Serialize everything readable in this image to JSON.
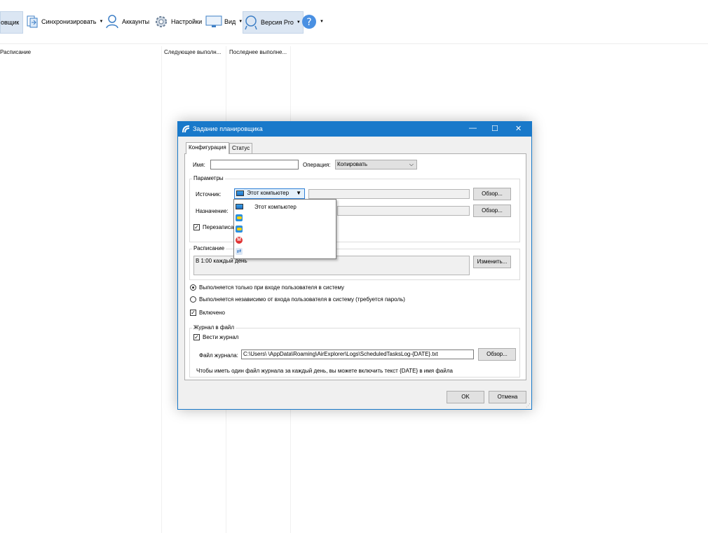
{
  "toolbar": {
    "items": [
      {
        "label": "овщик",
        "selected": true
      },
      {
        "label": "Синхронизировать",
        "has_dropdown": true
      },
      {
        "label": "Аккаунты"
      },
      {
        "label": "Настройки"
      },
      {
        "label": "Вид",
        "has_dropdown": true
      },
      {
        "label": "Версия Pro",
        "has_dropdown": true,
        "selected": true
      },
      {
        "label": "",
        "icon": "help-icon",
        "has_dropdown": true
      }
    ]
  },
  "table": {
    "columns": [
      "Расписание",
      "Следующее выполн...",
      "Последнее выполне..."
    ]
  },
  "dialog": {
    "title": "Задание планировщика",
    "window_buttons": {
      "minimize": "—",
      "maximize": "☐",
      "close": "✕"
    },
    "tabs": [
      {
        "label": "Конфигурация",
        "active": true
      },
      {
        "label": "Статус",
        "active": false
      }
    ],
    "name_label": "Имя:",
    "name_value": "",
    "operation_label": "Операция:",
    "operation_value": "Копировать",
    "params_title": "Параметры",
    "source_label": "Источник:",
    "source_value": "Этот компьютер",
    "source_path": "",
    "browse_label": "Обзор...",
    "dest_label": "Назначение:",
    "dest_path": "",
    "overwrite_label": "Перезаписа",
    "overwrite_checked": true,
    "schedule_title": "Расписание",
    "schedule_text": "В 1:00 каждый день",
    "change_label": "Изменить...",
    "radio1_label": "Выполняется только при входе пользователя в систему",
    "radio1_selected": true,
    "radio2_label": "Выполняется независимо от входа пользователя в систему (требуется пароль)",
    "radio2_selected": false,
    "enabled_label": "Включено",
    "enabled_checked": true,
    "log_title": "Журнал в файл",
    "keep_log_label": "Вести журнал",
    "keep_log_checked": true,
    "log_file_label": "Файл журнала:",
    "log_file_value": "C:\\Users\\          \\AppData\\Roaming\\AirExplorer\\Logs\\ScheduledTasksLog-{DATE}.txt",
    "log_hint": "Чтобы иметь один файл журнала за каждый день, вы можете включить текст {DATE} в имя файла",
    "ok_label": "OK",
    "cancel_label": "Отмена"
  },
  "dropdown": {
    "items": [
      {
        "label": "Этот компьютер",
        "icon": "monitor-icon"
      },
      {
        "label": "",
        "icon": "cloud-icon"
      },
      {
        "label": "",
        "icon": "cloud-icon"
      },
      {
        "label": "",
        "icon": "mega-icon"
      },
      {
        "label": "",
        "icon": "sync-icon"
      }
    ]
  },
  "colors": {
    "accent": "#1979ca",
    "toolbar_selected": "#dbe6f3"
  }
}
